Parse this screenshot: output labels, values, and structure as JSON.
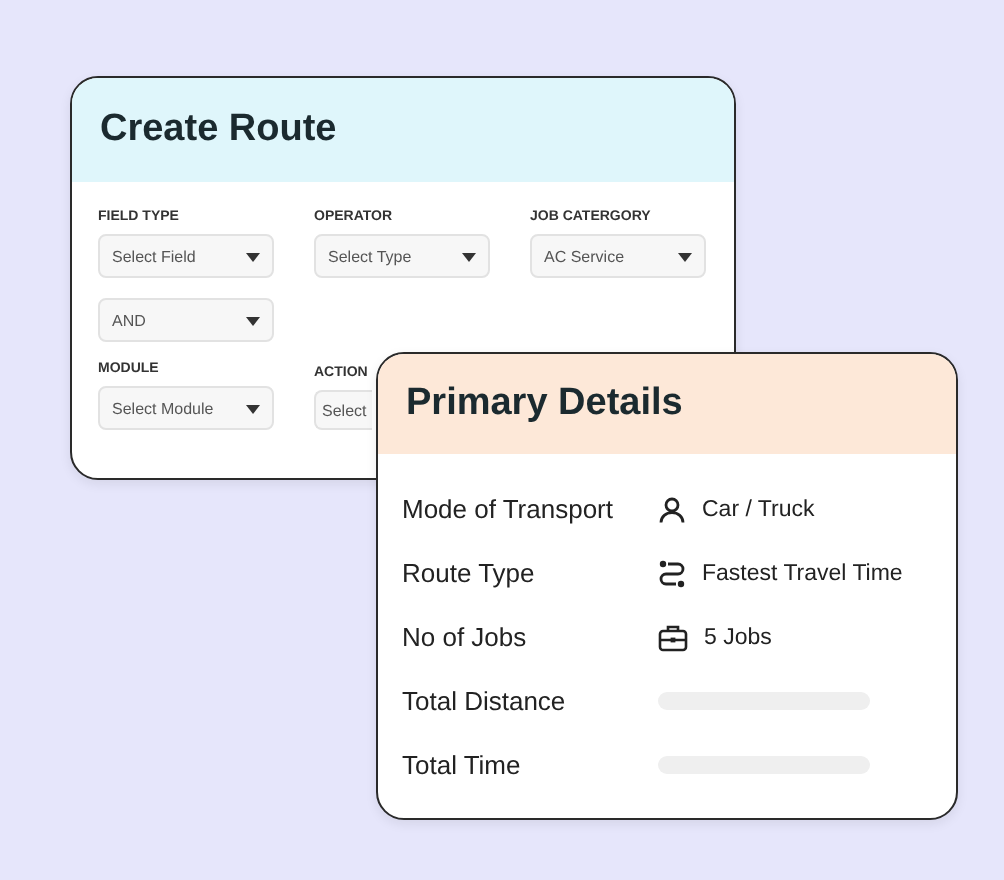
{
  "create_route": {
    "title": "Create Route",
    "fields": [
      {
        "label": "FIELD TYPE",
        "value": "Select Field"
      },
      {
        "label": "OPERATOR",
        "value": "Select Type"
      },
      {
        "label": "JOB CATERGORY",
        "value": "AC Service"
      },
      {
        "value": "AND"
      },
      {
        "label": "MODULE",
        "value": "Select Module"
      },
      {
        "label": "ACTION",
        "value": "Select"
      }
    ]
  },
  "primary_details": {
    "title": "Primary Details",
    "rows": [
      {
        "label": "Mode of Transport",
        "kind": "person",
        "value": "Car / Truck"
      },
      {
        "label": "Route Type",
        "kind": "route",
        "value": "Fastest Travel Time"
      },
      {
        "label": "No of Jobs",
        "kind": "briefcase",
        "value": "5 Jobs"
      },
      {
        "label": "Total Distance",
        "kind": "empty"
      },
      {
        "label": "Total Time",
        "kind": "empty"
      }
    ]
  }
}
